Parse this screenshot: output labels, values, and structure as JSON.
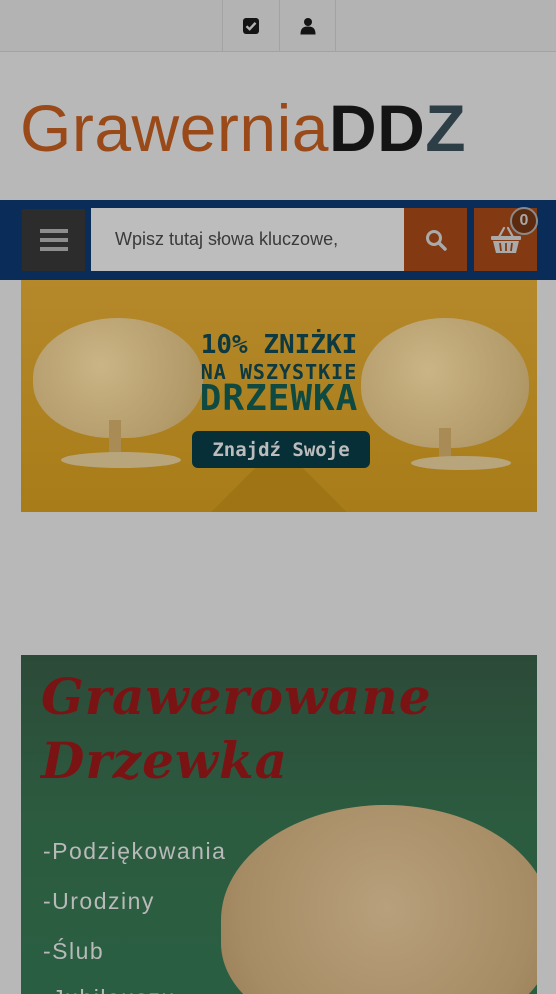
{
  "topbar": {
    "buttons": [
      {
        "icon": "check-square-icon"
      },
      {
        "icon": "user-icon"
      }
    ]
  },
  "logo": {
    "part1": "Grawernia",
    "part2": "DD",
    "part3": "Z"
  },
  "nav": {
    "menu_icon": "hamburger-icon",
    "search": {
      "placeholder": "Wpisz tutaj słowa kluczowe,",
      "value": ""
    },
    "search_icon": "search-icon",
    "cart_icon": "basket-icon",
    "cart_count": "0"
  },
  "promo_banner": {
    "line1": "10% ZNIŻKI",
    "line2": "NA WSZYSTKIE",
    "line3": "DRZEWKA",
    "cta": "Znajdź Swoje"
  },
  "category_banner": {
    "title_line1": "Grawerowane",
    "title_line2": "Drzewka",
    "items": [
      "-Podziękowania",
      "-Urodziny",
      "-Ślub",
      "-Jubileuszu"
    ]
  },
  "colors": {
    "navbar": "#092c59",
    "accent": "#833a12",
    "menu_button": "#2c2c2c",
    "logo_orange": "#9a4a18",
    "logo_blue": "#2d3e47"
  }
}
